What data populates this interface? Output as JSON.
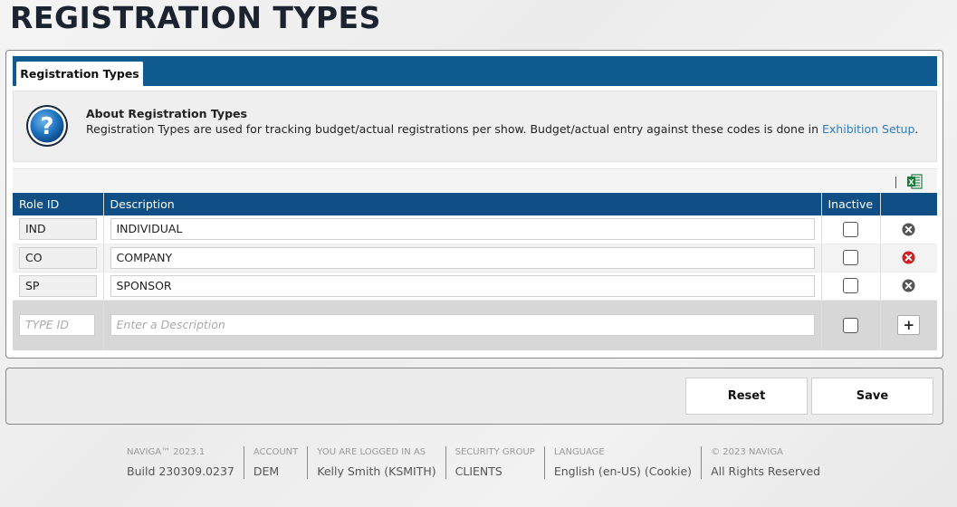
{
  "page": {
    "title": "REGISTRATION TYPES"
  },
  "tabs": [
    {
      "label": "Registration Types"
    }
  ],
  "about": {
    "title": "About Registration Types",
    "text": "Registration Types are used for tracking budget/actual registrations per show. Budget/actual entry against these codes is done in ",
    "link_text": "Exhibition Setup",
    "text_after": "."
  },
  "toolbar": {
    "export_icon": "excel-icon"
  },
  "table": {
    "headers": {
      "role_id": "Role ID",
      "description": "Description",
      "inactive": "Inactive",
      "action": ""
    },
    "rows": [
      {
        "role_id": "IND",
        "description": "INDIVIDUAL",
        "inactive": false,
        "delete_icon": "delete-icon",
        "delete_color": "#555555"
      },
      {
        "role_id": "CO",
        "description": "COMPANY",
        "inactive": false,
        "delete_icon": "delete-icon",
        "delete_color": "#cc2222"
      },
      {
        "role_id": "SP",
        "description": "SPONSOR",
        "inactive": false,
        "delete_icon": "delete-icon",
        "delete_color": "#555555"
      }
    ],
    "new_row": {
      "id_placeholder": "TYPE ID",
      "description_placeholder": "Enter a Description",
      "inactive": false,
      "add_label": "+"
    }
  },
  "actions": {
    "reset_label": "Reset",
    "save_label": "Save"
  },
  "footer": [
    {
      "label": "NAVIGA™ 2023.1",
      "value": "Build 230309.0237"
    },
    {
      "label": "ACCOUNT",
      "value": "DEM"
    },
    {
      "label": "YOU ARE LOGGED IN AS",
      "value": "Kelly Smith (KSMITH)"
    },
    {
      "label": "SECURITY GROUP",
      "value": "CLIENTS"
    },
    {
      "label": "LANGUAGE",
      "value": "English (en-US) (Cookie)"
    },
    {
      "label": "© 2023 NAVIGA",
      "value": "All Rights Reserved"
    }
  ],
  "colors": {
    "brand_blue": "#0f5a8e",
    "header_blue": "#0f4f85",
    "link": "#2f7dbf",
    "excel_green": "#1d7a3c"
  }
}
